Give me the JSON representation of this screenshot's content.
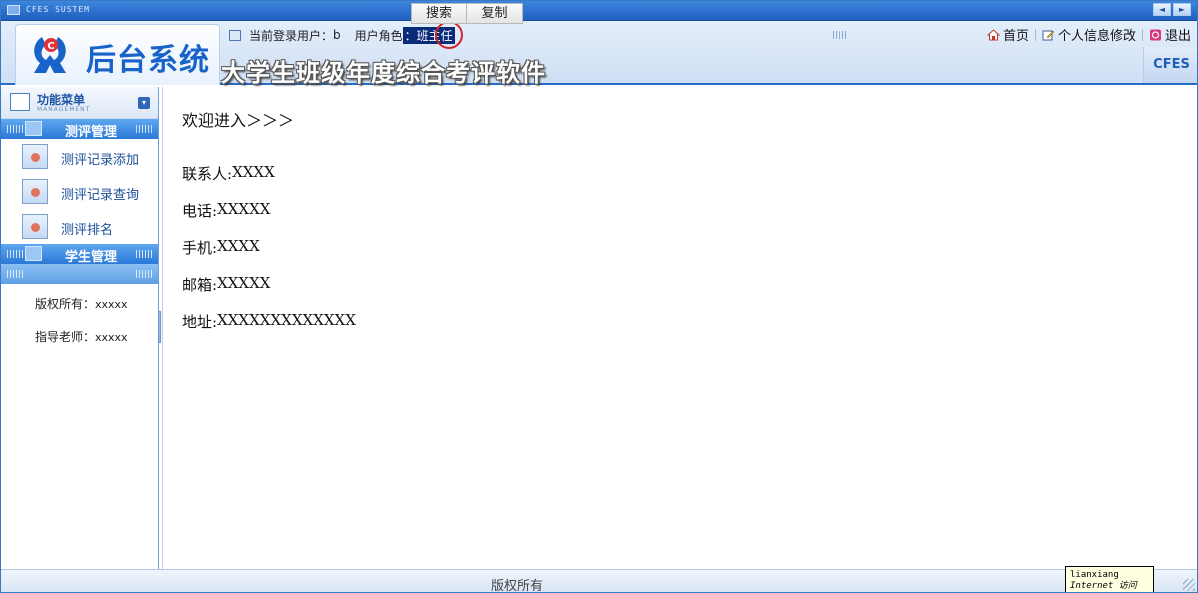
{
  "window": {
    "system_label": "CFES SUSTEM",
    "nav_left": "◄",
    "nav_right": "►"
  },
  "context_popup": {
    "search": "搜索",
    "copy": "复制"
  },
  "header": {
    "logo_text": "后台系统",
    "current_user_label": "当前登录用户：",
    "current_user": "b",
    "role_label": "用户角色",
    "role_colon": "：",
    "role_value": "班主任",
    "subtitle": "大学生班级年度综合考评软件",
    "brand_badge": "CFES",
    "links": {
      "home": "首页",
      "profile": "个人信息修改",
      "logout": "退出"
    }
  },
  "sidebar": {
    "header_title": "功能菜单",
    "header_subtitle": "MANAGEMENT",
    "sections": [
      {
        "title": "测评管理",
        "items": [
          "测评记录添加",
          "测评记录查询",
          "测评排名"
        ]
      },
      {
        "title": "学生管理",
        "items": []
      }
    ],
    "copyright_label": "版权所有：",
    "copyright_value": "xxxxx",
    "advisor_label": "指导老师：",
    "advisor_value": "xxxxx"
  },
  "main": {
    "welcome": "欢迎进入＞＞＞",
    "contact": [
      {
        "label": "联系人:",
        "value": "XXXX"
      },
      {
        "label": "电话:",
        "value": "XXXXX"
      },
      {
        "label": "手机:",
        "value": "XXXX"
      },
      {
        "label": "邮箱:",
        "value": "XXXXX"
      },
      {
        "label": "地址:",
        "value": "XXXXXXXXXXXXX"
      }
    ]
  },
  "footer": {
    "text": "版权所有"
  },
  "tooltip": {
    "line1": "lianxiang",
    "line2": "Internet 访问"
  },
  "colors": {
    "accent": "#2a78d6",
    "title_bar": "#1f5fc0",
    "role_highlight": "#0a2a7a",
    "annotation_circle": "#d0242a"
  }
}
